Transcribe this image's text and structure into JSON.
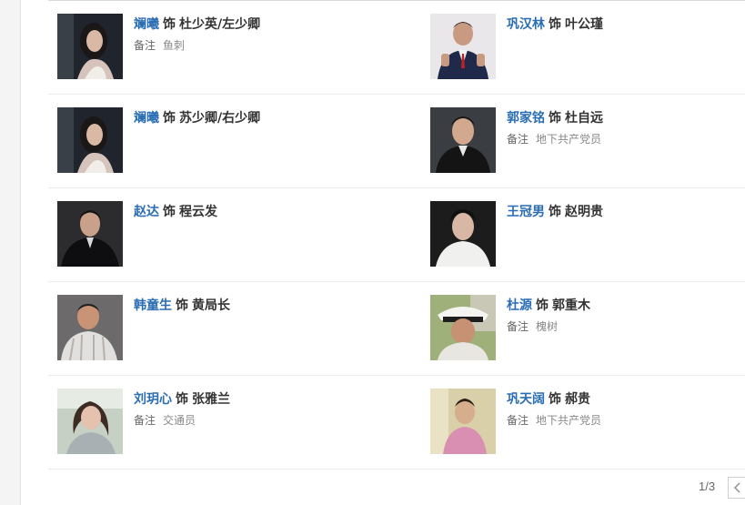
{
  "cast": [
    [
      {
        "actor": "斓曦",
        "shi": "饰",
        "role": "杜少英/左少卿",
        "note_label": "备注",
        "note": "鱼刺",
        "photo": "woman-dark-hair"
      },
      {
        "actor": "巩汉林",
        "shi": "饰",
        "role": "叶公瑾",
        "note_label": "",
        "note": "",
        "photo": "man-suit-thumbs-up"
      }
    ],
    [
      {
        "actor": "斓曦",
        "shi": "饰",
        "role": "苏少卿/右少卿",
        "note_label": "",
        "note": "",
        "photo": "woman-dark-hair"
      },
      {
        "actor": "郭家铭",
        "shi": "饰",
        "role": "杜自远",
        "note_label": "备注",
        "note": "地下共产党员",
        "photo": "man-dark-suit"
      }
    ],
    [
      {
        "actor": "赵达",
        "shi": "饰",
        "role": "程云发",
        "note_label": "",
        "note": "",
        "photo": "man-black-suit"
      },
      {
        "actor": "王冠男",
        "shi": "饰",
        "role": "赵明贵",
        "note_label": "",
        "note": "",
        "photo": "man-white-tee"
      }
    ],
    [
      {
        "actor": "韩童生",
        "shi": "饰",
        "role": "黄局长",
        "note_label": "",
        "note": "",
        "photo": "man-striped-shirt"
      },
      {
        "actor": "杜源",
        "shi": "饰",
        "role": "郭重木",
        "note_label": "备注",
        "note": "槐树",
        "photo": "man-captain-hat"
      }
    ],
    [
      {
        "actor": "刘玥心",
        "shi": "饰",
        "role": "张雅兰",
        "note_label": "备注",
        "note": "交通员",
        "photo": "woman-long-hair"
      },
      {
        "actor": "巩天阔",
        "shi": "饰",
        "role": "郝贵",
        "note_label": "备注",
        "note": "地下共产党员",
        "photo": "man-pink-shirt"
      }
    ]
  ],
  "pager": {
    "indicator": "1/3",
    "prev_icon": "chevron-left-icon"
  },
  "colors": {
    "actor_link": "#2a6db3",
    "text": "#333333",
    "note": "#888888"
  }
}
